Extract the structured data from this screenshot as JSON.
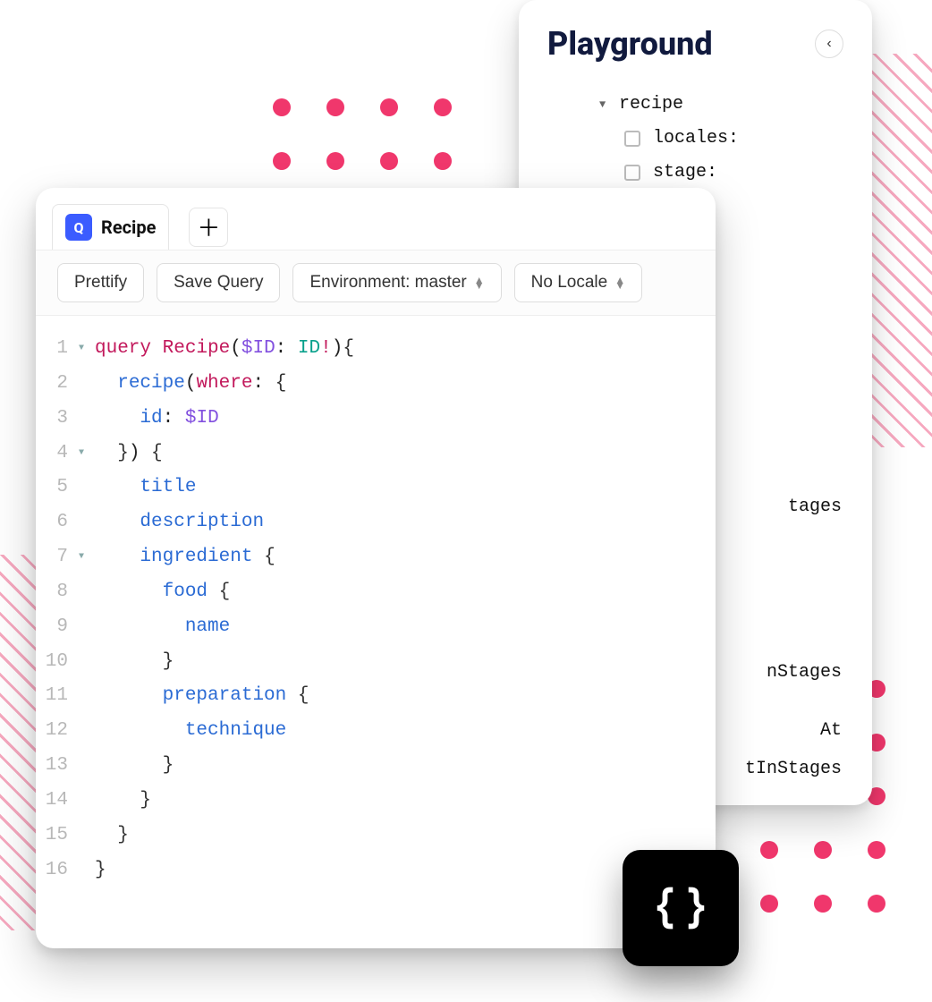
{
  "playground": {
    "title": "Playground",
    "tree": {
      "root": "recipe",
      "children": [
        {
          "label": "locales:"
        },
        {
          "label": "stage:"
        }
      ]
    },
    "peeks": {
      "p1": "tages",
      "p2": "nStages",
      "p3": "At",
      "p4": "tInStages"
    }
  },
  "editor": {
    "tab": {
      "badge": "Q",
      "label": "Recipe"
    },
    "toolbar": {
      "prettify": "Prettify",
      "save": "Save Query",
      "env": "Environment: master",
      "locale": "No Locale"
    },
    "lines": {
      "l1_query": "query",
      "l1_name": "Recipe",
      "l1_var": "$ID",
      "l1_type": "ID",
      "l2_fn": "recipe",
      "l2_arg": "where",
      "l3_key": "id",
      "l3_var": "$ID",
      "l5": "title",
      "l6": "description",
      "l7": "ingredient",
      "l8": "food",
      "l9": "name",
      "l11": "preparation",
      "l12": "technique"
    },
    "line_numbers": [
      "1",
      "2",
      "3",
      "4",
      "5",
      "6",
      "7",
      "8",
      "9",
      "10",
      "11",
      "12",
      "13",
      "14",
      "15",
      "16"
    ]
  }
}
